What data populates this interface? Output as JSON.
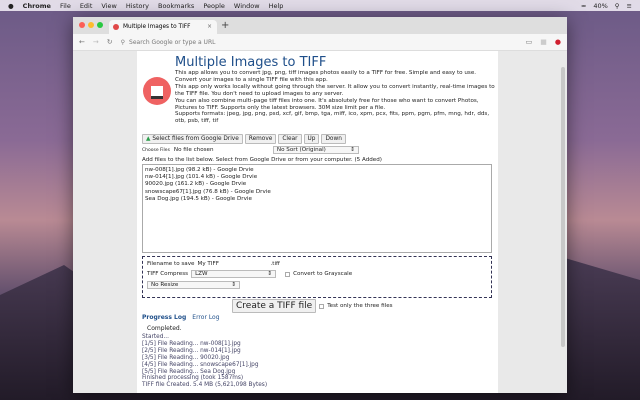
{
  "menubar": {
    "app": "Chrome",
    "items": [
      "File",
      "Edit",
      "View",
      "History",
      "Bookmarks",
      "People",
      "Window",
      "Help"
    ],
    "battery": "40%"
  },
  "browser": {
    "tab_title": "Multiple Images to TIFF",
    "omnibox_placeholder": "Search Google or type a URL"
  },
  "app": {
    "title": "Multiple Images to TIFF",
    "description": [
      "This app allows you to convert jpg, png, tiff images photos easily to a TIFF for free. Simple and easy to use. Convert your images to a single TIFF file with this app.",
      "This app only works locally without going through the server. It allow you to convert instantly, real-time images to the TIFF file. You don't need to upload images to any server.",
      "You can also combine multi-page tiff files into one. It's absolutely free for those who want to convert Photos, Pictures to TIFF. Supports only the latest browsers. 30M size limit per a file.",
      "Supports formats: jpeg, jpg, png, psd, xcf, gif, bmp, tga, miff, ico, xpm, pcx, fits, ppm, pgm, pfm, mng, hdr, dds, otb, psb, tiff, tif"
    ],
    "buttons": {
      "drive": "Select files from Google Drive",
      "remove": "Remove",
      "clear": "Clear",
      "up": "Up",
      "down": "Down",
      "choose": "Choose Files",
      "create": "Create a TIFF file"
    },
    "no_file": "No file chosen",
    "sort": "No Sort (Original)",
    "add_label": "Add files to the list below. Select from Google Drive or from your computer. (5 Added)",
    "files": [
      "nw-008[1].jpg (98.2 kB) - Google Drvie",
      "nw-014[1].jpg (101.4 kB) - Google Drvie",
      "90020.jpg (161.2 kB) - Google Drvie",
      "snowscape67[1].jpg (76.8 kB) - Google Drvie",
      "Sea Dog.jpg (194.5 kB) - Google Drvie"
    ],
    "filename_label": "Filename to save",
    "filename": "My TIFF",
    "ext": ".tiff",
    "compress_label": "TIFF Compress",
    "compress": "LZW",
    "grayscale": "Convert to Grayscale",
    "resize": "No Resize",
    "test_only": "Test only the three files",
    "log_tabs": [
      "Progress Log",
      "Error Log"
    ],
    "status": "Completed.",
    "log": [
      "Started...",
      "[1/5] File Reading... nw-008[1].jpg",
      "[2/5] File Reading... nw-014[1].jpg",
      "[3/5] File Reading... 90020.jpg",
      "[4/5] File Reading... snowscape67[1].jpg",
      "[5/5] File Reading... Sea Dog.jpg",
      "Finished processing (took 1587ms)",
      "TIFF file Created. 5.4 MB (5,621,098 Bytes)"
    ]
  }
}
